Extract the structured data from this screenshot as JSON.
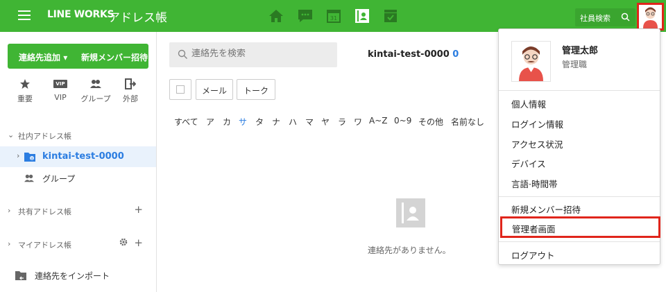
{
  "header": {
    "brand": "LINE WORKS",
    "app_title": "アドレス帳",
    "employee_search": "社員検索",
    "nav_icons": [
      "home-icon",
      "talk-icon",
      "calendar-icon",
      "contacts-icon",
      "drive-icon"
    ],
    "calendar_day": "31",
    "accent": "#40b534"
  },
  "sidebar": {
    "add_contact": "連絡先追加",
    "invite": "新規メンバー招待",
    "quick": [
      {
        "icon": "star-icon",
        "label": "重要"
      },
      {
        "icon": "vip-icon",
        "label": "VIP",
        "badge": "VIP"
      },
      {
        "icon": "group-icon",
        "label": "グループ"
      },
      {
        "icon": "external-icon",
        "label": "外部"
      }
    ],
    "internal_section": "社内アドレス帳",
    "tenant": "kintai-test-0000",
    "group": "グループ",
    "shared_section": "共有アドレス帳",
    "my_section": "マイアドレス帳",
    "import": "連絡先をインポート"
  },
  "main": {
    "search_placeholder": "連絡先を検索",
    "domain_title": "kintai-test-0000",
    "count": "0",
    "mail_btn": "メール",
    "talk_btn": "トーク",
    "kana": [
      "すべて",
      "ア",
      "カ",
      "サ",
      "タ",
      "ナ",
      "ハ",
      "マ",
      "ヤ",
      "ラ",
      "ワ",
      "A~Z",
      "0~9",
      "その他",
      "名前なし"
    ],
    "active_kana": "サ",
    "empty_text": "連絡先がありません。"
  },
  "dropdown": {
    "name": "管理太郎",
    "role": "管理職",
    "items": [
      "個人情報",
      "ログイン情報",
      "アクセス状況",
      "デバイス",
      "言語·時間帯"
    ],
    "invite": "新規メンバー招待",
    "admin": "管理者画面",
    "logout": "ログアウト",
    "highlight_color": "#e0251b"
  }
}
